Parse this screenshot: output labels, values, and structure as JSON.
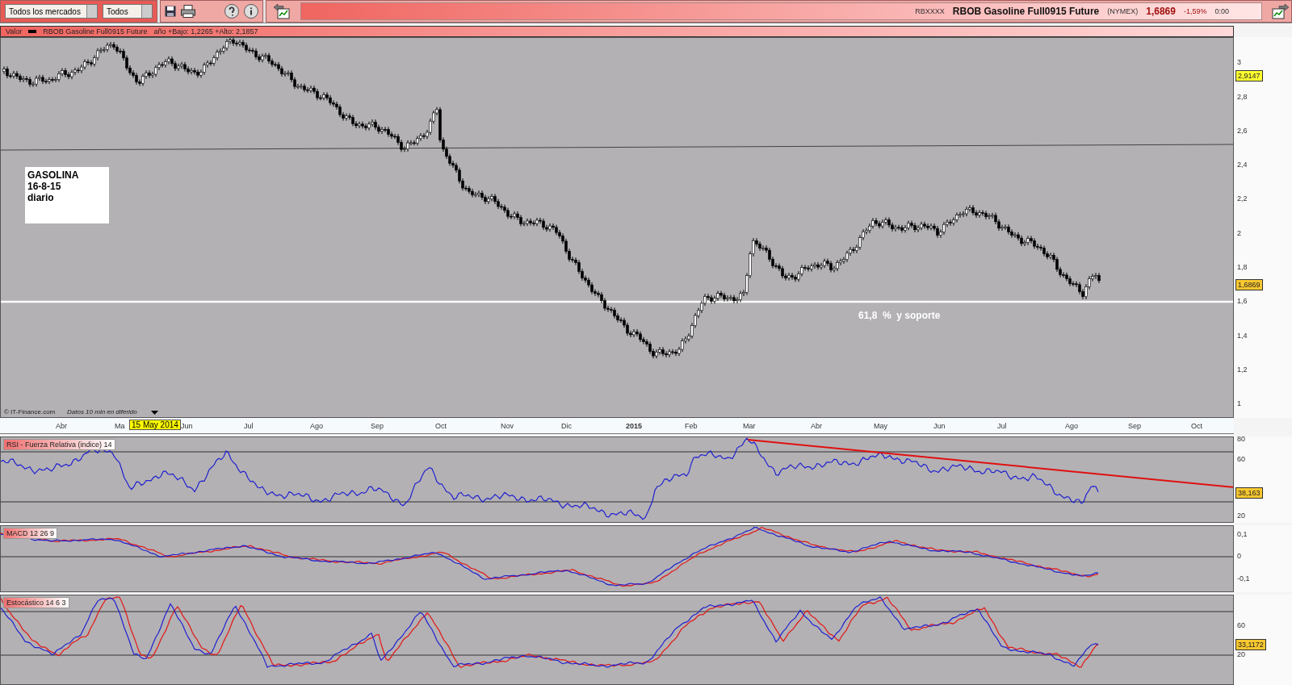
{
  "toolbar": {
    "market_select": "Todos los mercados",
    "type_select": "Todos"
  },
  "quote": {
    "symbol": "RBXXXX",
    "name": "RBOB Gasoline Full0915 Future",
    "exchange": "(NYMEX)",
    "price": "1,6869",
    "change": "-1,59%",
    "time": "0:00"
  },
  "legend": {
    "label": "Valor",
    "series": "RBOB Gasoline Full0915 Future",
    "range": "año +Bajo: 1,2265 +Alto: 2,1857"
  },
  "price_chart": {
    "y_labels": [
      "3",
      "2,8",
      "2,6",
      "2,4",
      "2,2",
      "2",
      "1,8",
      "1,6",
      "1,4",
      "1,2",
      "1"
    ],
    "tags": [
      {
        "kind": "marker",
        "text": "2,9147"
      },
      {
        "kind": "last",
        "text": "1,6869"
      }
    ],
    "note": [
      "GASOLINA",
      "16-8-15",
      "diario"
    ],
    "annotation": "61,8  %  y soporte",
    "source": "© IT-Finance.com",
    "delay": "Datos 10 min en diferido"
  },
  "time_axis": {
    "labels": [
      "Abr",
      "Ma",
      "Jun",
      "Jul",
      "Ago",
      "Sep",
      "Oct",
      "Nov",
      "Dic",
      "2015",
      "Feb",
      "Mar",
      "Abr",
      "May",
      "Jun",
      "Jul",
      "Ago",
      "Sep",
      "Oct"
    ],
    "tooltip": "15 May 2014"
  },
  "indicators": [
    {
      "kind": "rsi",
      "title": "RSI - Fuerza Relativa (indice) 14",
      "y_labels": [
        "80",
        "60",
        "20"
      ],
      "value_tag": "38,163"
    },
    {
      "kind": "macd",
      "title": "MACD 12 26 9",
      "y_labels": [
        "0,1",
        "0",
        "-0,1"
      ]
    },
    {
      "kind": "stochastic",
      "title": "Estocástico 14 6 3",
      "y_labels": [
        "60",
        "20"
      ],
      "value_tag": "33,1172"
    }
  ]
}
